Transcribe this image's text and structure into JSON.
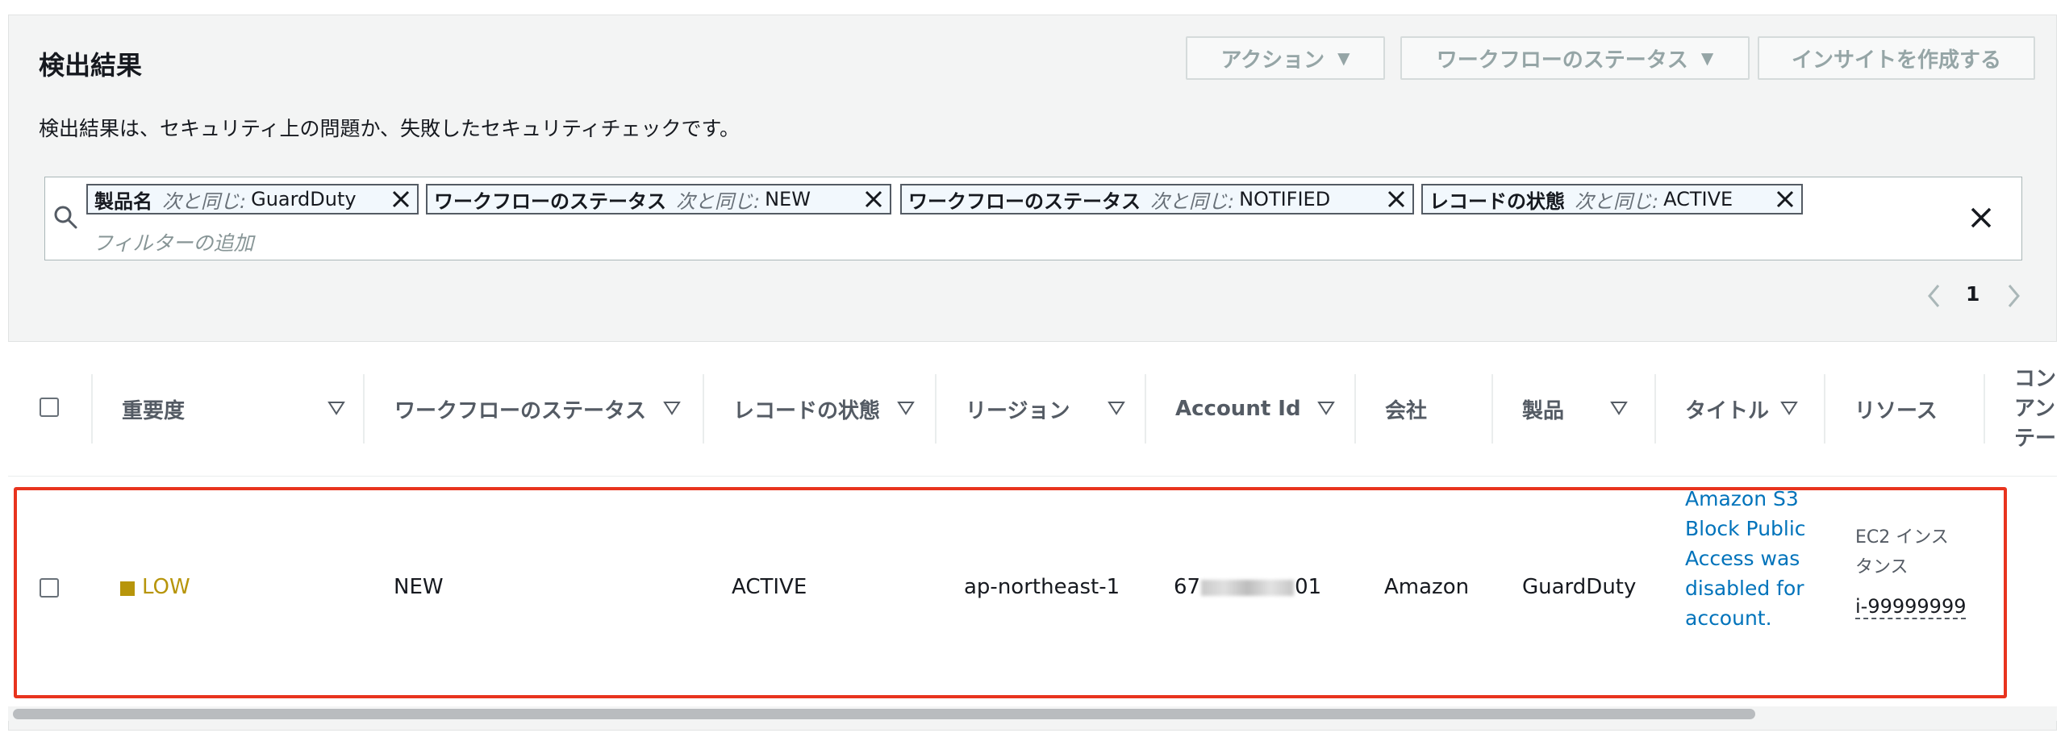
{
  "header": {
    "title": "検出結果",
    "description": "検出結果は、セキュリティ上の問題か、失敗したセキュリティチェックです。",
    "actions_label": "アクション",
    "workflow_status_label": "ワークフローのステータス",
    "create_insight_label": "インサイトを作成する"
  },
  "filters": {
    "tokens": [
      {
        "key": "製品名",
        "operator": "次と同じ:",
        "value": "GuardDuty"
      },
      {
        "key": "ワークフローのステータス",
        "operator": "次と同じ:",
        "value": "NEW"
      },
      {
        "key": "ワークフローのステータス",
        "operator": "次と同じ:",
        "value": "NOTIFIED"
      },
      {
        "key": "レコードの状態",
        "operator": "次と同じ:",
        "value": "ACTIVE"
      }
    ],
    "placeholder": "フィルターの追加"
  },
  "pagination": {
    "current_page": "1"
  },
  "table": {
    "columns": [
      "重要度",
      "ワークフローのステータス",
      "レコードの状態",
      "リージョン",
      "Account Id",
      "会社",
      "製品",
      "タイトル",
      "リソース",
      "コンプライアンスステータス"
    ],
    "truncated_last_column": [
      "コン",
      "アン",
      "テー"
    ],
    "rows": [
      {
        "severity": "LOW",
        "workflow_status": "NEW",
        "record_state": "ACTIVE",
        "region": "ap-northeast-1",
        "account_id_prefix": "67",
        "account_id_suffix": "01",
        "company": "Amazon",
        "product": "GuardDuty",
        "title": "Amazon S3 Block Public Access was disabled for account.",
        "resource_type": "EC2 インスタンス",
        "resource_id": "i-99999999"
      }
    ]
  },
  "colors": {
    "severity_low": "#b7950b",
    "link": "#0073bb",
    "highlight_border": "#e8341e"
  }
}
